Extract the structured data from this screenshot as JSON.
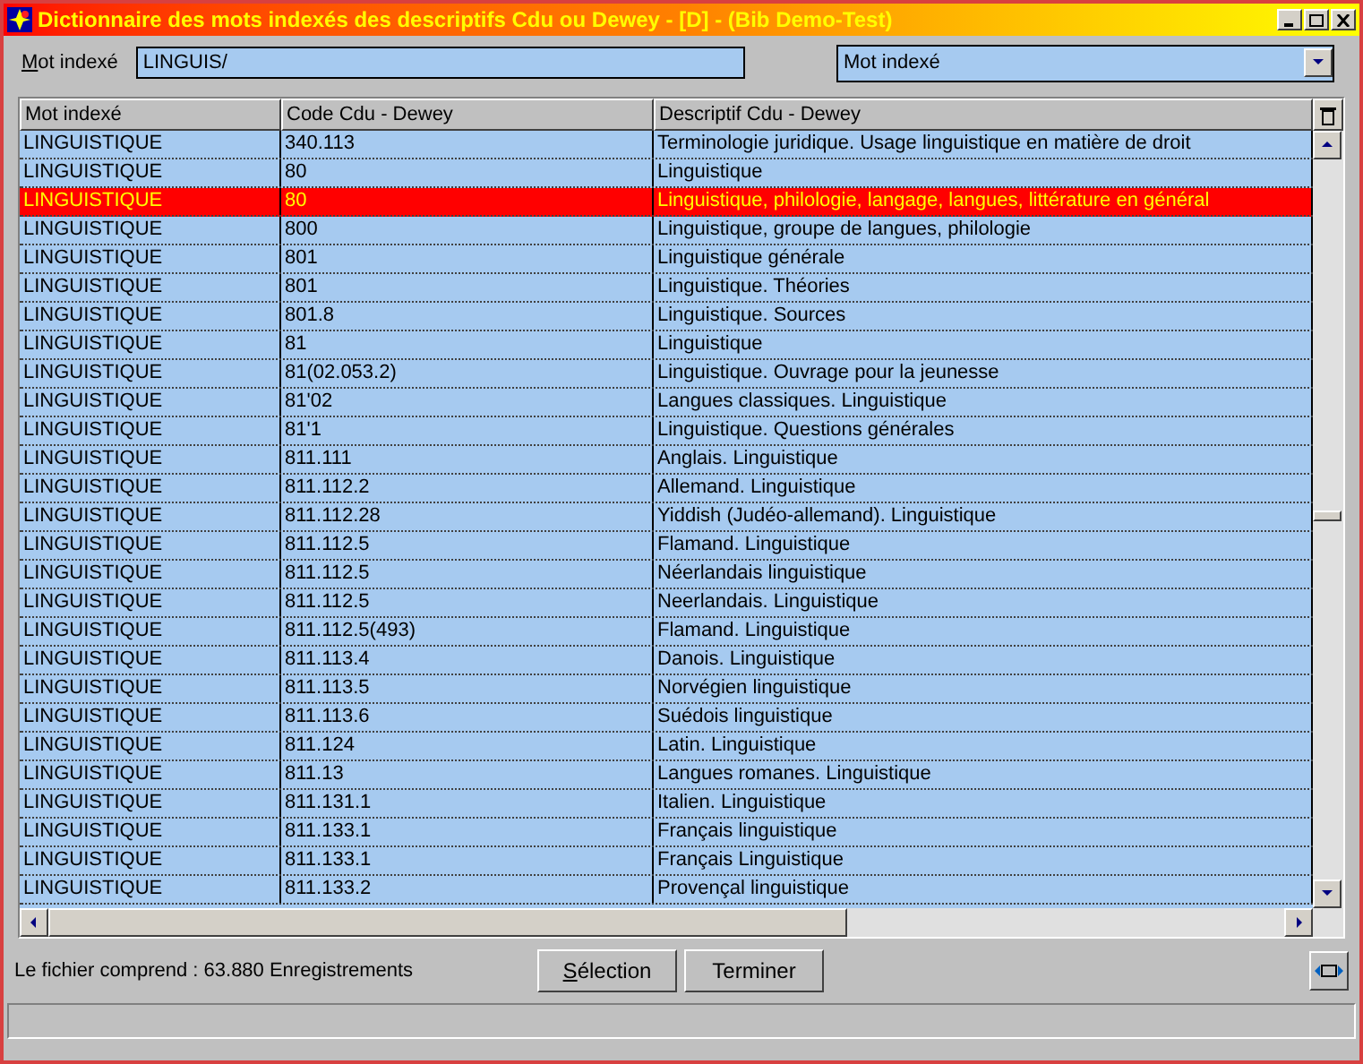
{
  "window": {
    "title": "Dictionnaire des mots indexés des descriptifs Cdu ou Dewey - [D] - (Bib Demo-Test)"
  },
  "search": {
    "label": "Mot indexé",
    "value": "LINGUIS/"
  },
  "index_select": {
    "value": "Mot indexé"
  },
  "table": {
    "columns": [
      "Mot indexé",
      "Code Cdu - Dewey",
      "Descriptif Cdu - Dewey"
    ],
    "rows": [
      {
        "mot": "LINGUISTIQUE",
        "code": "340.113",
        "desc": "Terminologie juridique. Usage linguistique en matière de droit",
        "selected": false
      },
      {
        "mot": "LINGUISTIQUE",
        "code": "80",
        "desc": "Linguistique",
        "selected": false
      },
      {
        "mot": "LINGUISTIQUE",
        "code": "80",
        "desc": "Linguistique, philologie, langage, langues, littérature en général",
        "selected": true
      },
      {
        "mot": "LINGUISTIQUE",
        "code": "800",
        "desc": "Linguistique, groupe de langues, philologie",
        "selected": false
      },
      {
        "mot": "LINGUISTIQUE",
        "code": "801",
        "desc": "Linguistique générale",
        "selected": false
      },
      {
        "mot": "LINGUISTIQUE",
        "code": "801",
        "desc": "Linguistique. Théories",
        "selected": false
      },
      {
        "mot": "LINGUISTIQUE",
        "code": "801.8",
        "desc": "Linguistique. Sources",
        "selected": false
      },
      {
        "mot": "LINGUISTIQUE",
        "code": "81",
        "desc": "Linguistique",
        "selected": false
      },
      {
        "mot": "LINGUISTIQUE",
        "code": "81(02.053.2)",
        "desc": "Linguistique. Ouvrage pour la jeunesse",
        "selected": false
      },
      {
        "mot": "LINGUISTIQUE",
        "code": "81'02",
        "desc": "Langues classiques. Linguistique",
        "selected": false
      },
      {
        "mot": "LINGUISTIQUE",
        "code": "81'1",
        "desc": "Linguistique. Questions générales",
        "selected": false
      },
      {
        "mot": "LINGUISTIQUE",
        "code": "811.111",
        "desc": "Anglais. Linguistique",
        "selected": false
      },
      {
        "mot": "LINGUISTIQUE",
        "code": "811.112.2",
        "desc": "Allemand. Linguistique",
        "selected": false
      },
      {
        "mot": "LINGUISTIQUE",
        "code": "811.112.28",
        "desc": "Yiddish (Judéo-allemand). Linguistique",
        "selected": false
      },
      {
        "mot": "LINGUISTIQUE",
        "code": "811.112.5",
        "desc": "Flamand. Linguistique",
        "selected": false
      },
      {
        "mot": "LINGUISTIQUE",
        "code": "811.112.5",
        "desc": "Néerlandais linguistique",
        "selected": false
      },
      {
        "mot": "LINGUISTIQUE",
        "code": "811.112.5",
        "desc": "Neerlandais. Linguistique",
        "selected": false
      },
      {
        "mot": "LINGUISTIQUE",
        "code": "811.112.5(493)",
        "desc": "Flamand. Linguistique",
        "selected": false
      },
      {
        "mot": "LINGUISTIQUE",
        "code": "811.113.4",
        "desc": "Danois. Linguistique",
        "selected": false
      },
      {
        "mot": "LINGUISTIQUE",
        "code": "811.113.5",
        "desc": "Norvégien linguistique",
        "selected": false
      },
      {
        "mot": "LINGUISTIQUE",
        "code": "811.113.6",
        "desc": "Suédois linguistique",
        "selected": false
      },
      {
        "mot": "LINGUISTIQUE",
        "code": "811.124",
        "desc": "Latin. Linguistique",
        "selected": false
      },
      {
        "mot": "LINGUISTIQUE",
        "code": "811.13",
        "desc": "Langues romanes. Linguistique",
        "selected": false
      },
      {
        "mot": "LINGUISTIQUE",
        "code": "811.131.1",
        "desc": "Italien. Linguistique",
        "selected": false
      },
      {
        "mot": "LINGUISTIQUE",
        "code": "811.133.1",
        "desc": "Français linguistique",
        "selected": false
      },
      {
        "mot": "LINGUISTIQUE",
        "code": "811.133.1",
        "desc": "Français Linguistique",
        "selected": false
      },
      {
        "mot": "LINGUISTIQUE",
        "code": "811.133.2",
        "desc": "Provençal linguistique",
        "selected": false
      }
    ]
  },
  "record_count": "Le fichier comprend : 63.880 Enregistrements",
  "buttons": [
    "Sélection",
    "Terminer"
  ]
}
